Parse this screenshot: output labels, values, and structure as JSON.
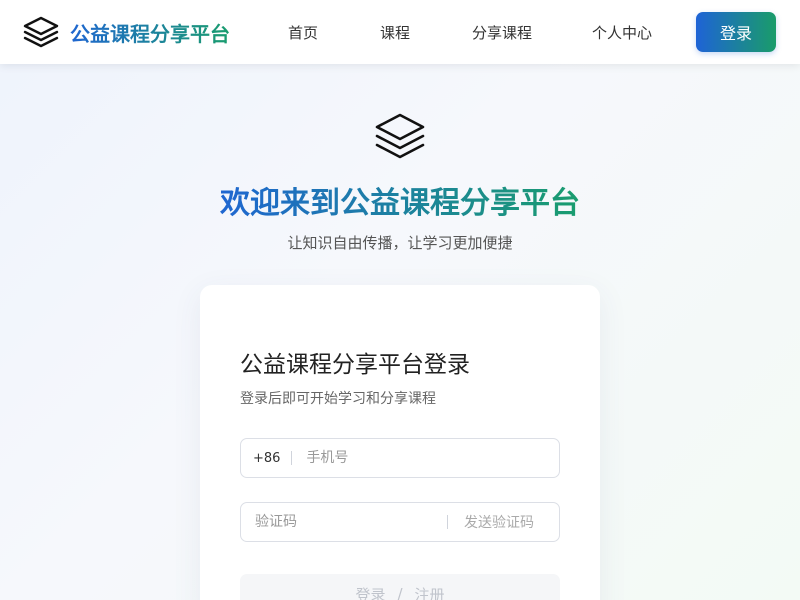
{
  "header": {
    "brand": "公益课程分享平台",
    "nav": {
      "home": "首页",
      "courses": "课程",
      "share": "分享课程",
      "profile": "个人中心"
    },
    "login_label": "登录"
  },
  "hero": {
    "title": "欢迎来到公益课程分享平台",
    "subtitle": "让知识自由传播，让学习更加便捷"
  },
  "login_card": {
    "title": "公益课程分享平台登录",
    "subtitle": "登录后即可开始学习和分享课程",
    "phone": {
      "prefix": "+86",
      "placeholder": "手机号",
      "value": ""
    },
    "code": {
      "placeholder": "验证码",
      "value": "",
      "send_label": "发送验证码"
    },
    "submit": {
      "login": "登录",
      "slash": "/",
      "register": "注册"
    }
  },
  "icons": {
    "brand_logo": "layers-icon",
    "hero_logo": "layers-icon"
  },
  "colors": {
    "gradient_start": "#1f66d1",
    "gradient_end": "#1a9d6e"
  }
}
